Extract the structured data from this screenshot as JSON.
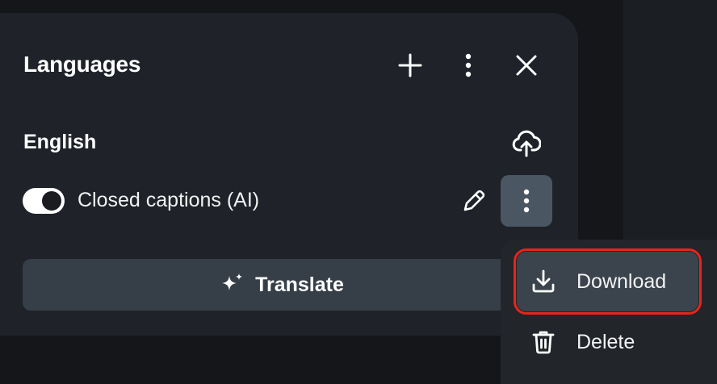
{
  "panel": {
    "title": "Languages",
    "header_icons": [
      "plus-icon",
      "more-vertical-icon",
      "close-icon"
    ]
  },
  "language": {
    "name": "English",
    "upload_icon": "cloud-upload-icon",
    "track": {
      "label": "Closed captions (AI)",
      "enabled": true,
      "icons": [
        "pencil-icon",
        "more-vertical-icon"
      ]
    }
  },
  "translate_button": {
    "label": "Translate",
    "icon": "sparkle-icon"
  },
  "context_menu": {
    "items": [
      {
        "label": "Download",
        "icon": "download-icon"
      },
      {
        "label": "Delete",
        "icon": "trash-icon"
      }
    ]
  },
  "colors": {
    "panel_bg": "#1f2329",
    "highlight": "#e8241a",
    "button_bg": "#363e47"
  }
}
